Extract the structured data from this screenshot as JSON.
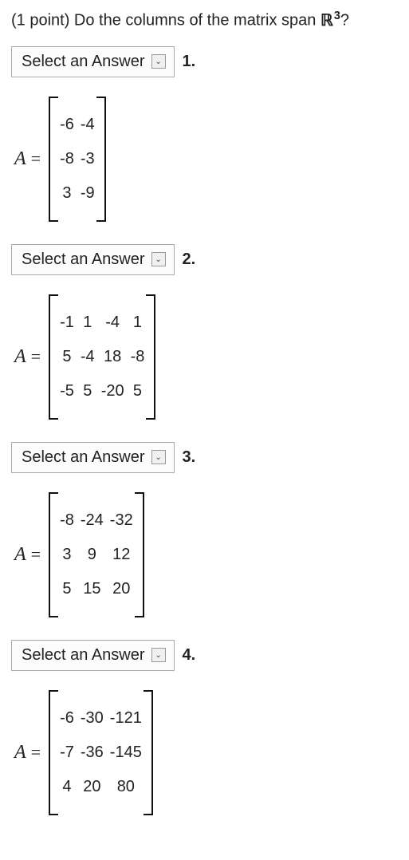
{
  "question": {
    "points_prefix": "(1 point) Do the columns of the matrix span ",
    "space_symbol": "ℝ",
    "exponent": "3",
    "suffix": "?"
  },
  "select_label": "Select an Answer",
  "items": [
    {
      "number": "1.",
      "lhs": "A",
      "rows": [
        [
          "-6",
          "-4"
        ],
        [
          "-8",
          "-3"
        ],
        [
          "3",
          "-9"
        ]
      ]
    },
    {
      "number": "2.",
      "lhs": "A",
      "rows": [
        [
          "-1",
          "1",
          "-4",
          "1"
        ],
        [
          "5",
          "-4",
          "18",
          "-8"
        ],
        [
          "-5",
          "5",
          "-20",
          "5"
        ]
      ]
    },
    {
      "number": "3.",
      "lhs": "A",
      "rows": [
        [
          "-8",
          "-24",
          "-32"
        ],
        [
          "3",
          "9",
          "12"
        ],
        [
          "5",
          "15",
          "20"
        ]
      ]
    },
    {
      "number": "4.",
      "lhs": "A",
      "rows": [
        [
          "-6",
          "-30",
          "-121"
        ],
        [
          "-7",
          "-36",
          "-145"
        ],
        [
          "4",
          "20",
          "80"
        ]
      ]
    }
  ]
}
